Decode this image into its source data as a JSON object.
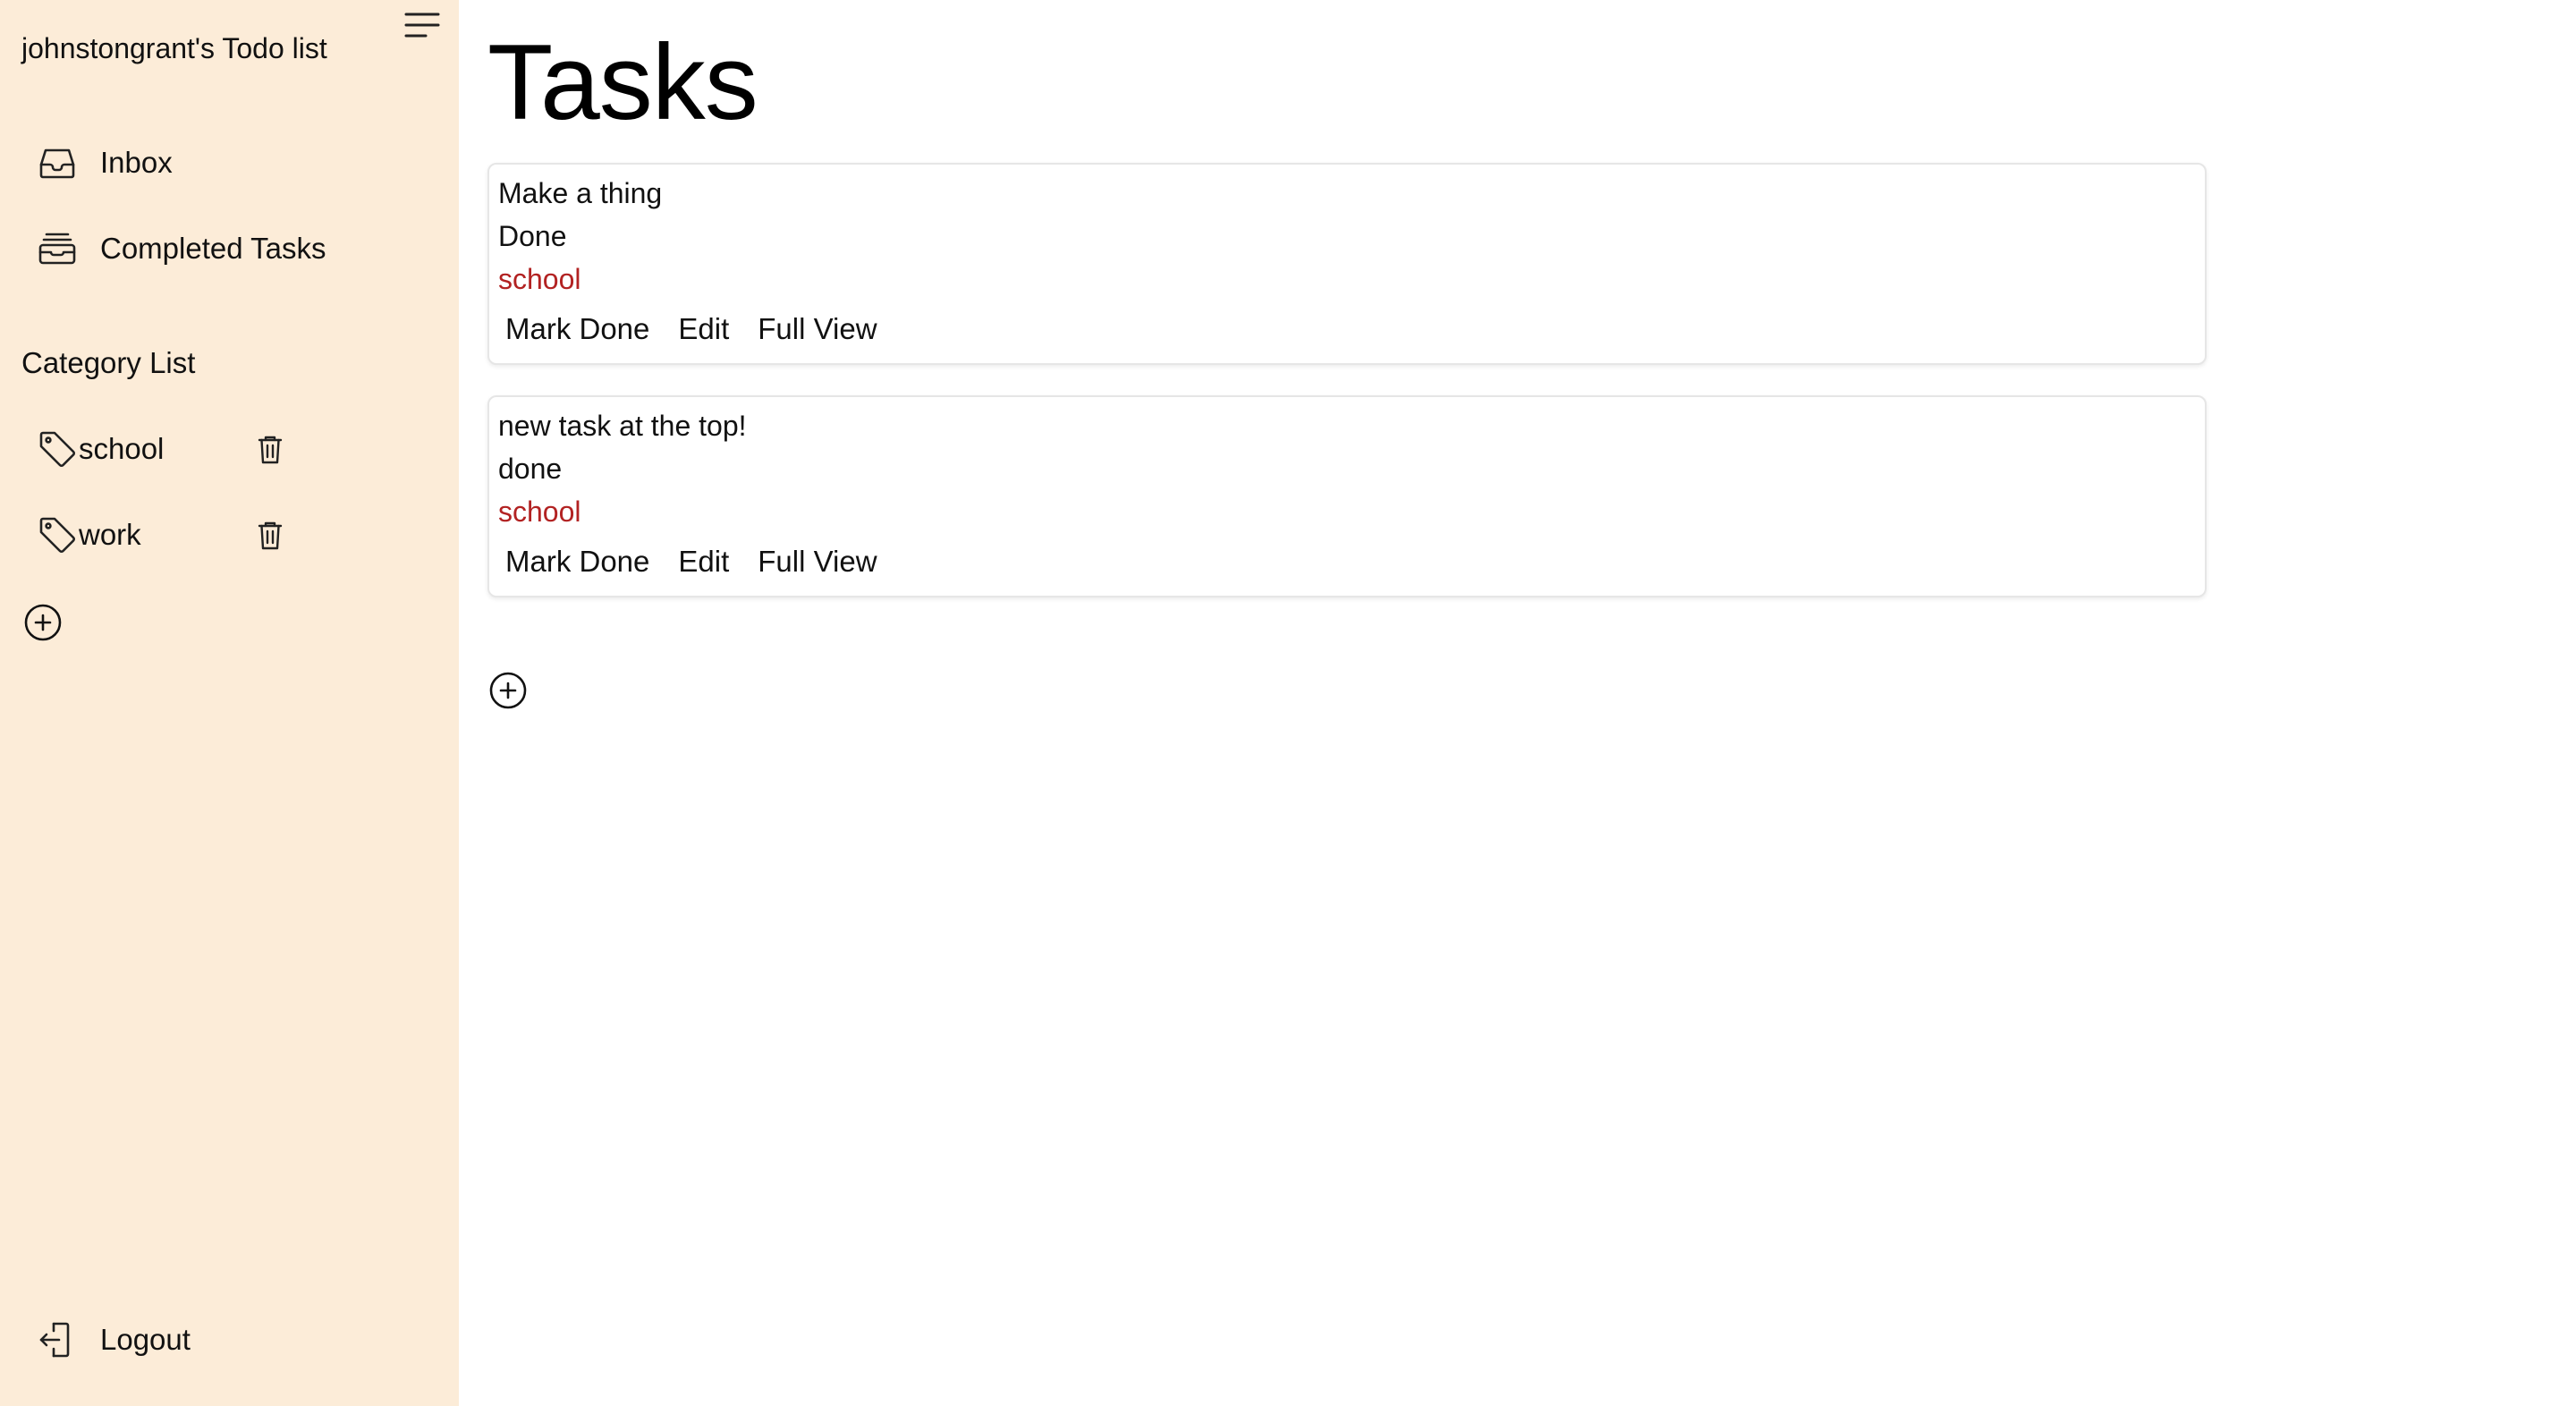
{
  "sidebar": {
    "title": "johnstongrant's Todo list",
    "menu_icon": "hamburger-menu-icon",
    "nav": [
      {
        "label": "Inbox",
        "icon": "inbox-icon"
      },
      {
        "label": "Completed Tasks",
        "icon": "archive-icon"
      }
    ],
    "category_title": "Category List",
    "categories": [
      {
        "label": "school",
        "icon": "tag-icon",
        "delete_icon": "trash-icon"
      },
      {
        "label": "work",
        "icon": "tag-icon",
        "delete_icon": "trash-icon"
      }
    ],
    "add_category_icon": "plus-circle-icon",
    "logout": {
      "label": "Logout",
      "icon": "logout-icon"
    }
  },
  "main": {
    "title": "Tasks",
    "tasks": [
      {
        "name": "Make a thing",
        "status": "Done",
        "category": "school",
        "actions": {
          "mark_done": "Mark Done",
          "edit": "Edit",
          "full_view": "Full View"
        }
      },
      {
        "name": "new task at the top!",
        "status": "done",
        "category": "school",
        "actions": {
          "mark_done": "Mark Done",
          "edit": "Edit",
          "full_view": "Full View"
        }
      }
    ],
    "add_task_icon": "plus-circle-icon"
  },
  "colors": {
    "sidebar_bg": "#fcecd8",
    "category_text": "#b22222",
    "card_border": "#e6e6e6"
  }
}
